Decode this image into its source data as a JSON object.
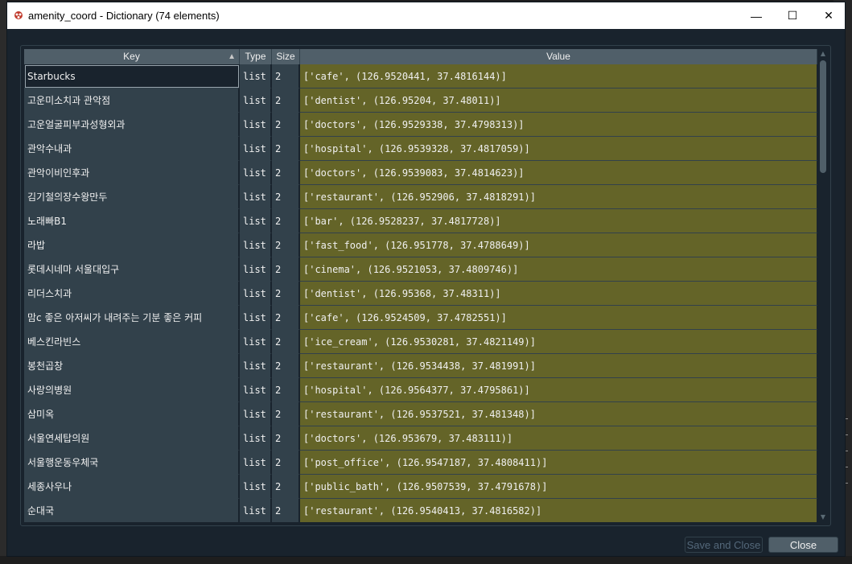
{
  "window": {
    "title": "amenity_coord - Dictionary (74 elements)",
    "controls": {
      "minimize": "—",
      "maximize": "☐",
      "close": "✕"
    }
  },
  "table": {
    "headers": {
      "key": "Key",
      "type": "Type",
      "size": "Size",
      "value": "Value"
    },
    "sort_indicator": "▲",
    "rows": [
      {
        "key": "Starbucks",
        "type": "list",
        "size": "2",
        "value": "['cafe', (126.9520441, 37.4816144)]"
      },
      {
        "key": "고운미소치과 관악점",
        "type": "list",
        "size": "2",
        "value": "['dentist', (126.95204, 37.48011)]"
      },
      {
        "key": "고운얼굴피부과성형외과",
        "type": "list",
        "size": "2",
        "value": "['doctors', (126.9529338, 37.4798313)]"
      },
      {
        "key": "관악수내과",
        "type": "list",
        "size": "2",
        "value": "['hospital', (126.9539328, 37.4817059)]"
      },
      {
        "key": "관악이비인후과",
        "type": "list",
        "size": "2",
        "value": "['doctors', (126.9539083, 37.4814623)]"
      },
      {
        "key": "김기철의장수왕만두",
        "type": "list",
        "size": "2",
        "value": "['restaurant', (126.952906, 37.4818291)]"
      },
      {
        "key": "노래빠B1",
        "type": "list",
        "size": "2",
        "value": "['bar', (126.9528237, 37.4817728)]"
      },
      {
        "key": "라밥",
        "type": "list",
        "size": "2",
        "value": "['fast_food', (126.951778, 37.4788649)]"
      },
      {
        "key": "롯데시네마 서울대입구",
        "type": "list",
        "size": "2",
        "value": "['cinema', (126.9521053, 37.4809746)]"
      },
      {
        "key": "리더스치과",
        "type": "list",
        "size": "2",
        "value": "['dentist', (126.95368, 37.48311)]"
      },
      {
        "key": "맘c 좋은 아저씨가 내려주는 기분 좋은 커피",
        "type": "list",
        "size": "2",
        "value": "['cafe', (126.9524509, 37.4782551)]"
      },
      {
        "key": "베스킨라빈스",
        "type": "list",
        "size": "2",
        "value": "['ice_cream', (126.9530281, 37.4821149)]"
      },
      {
        "key": "봉천곱창",
        "type": "list",
        "size": "2",
        "value": "['restaurant', (126.9534438, 37.481991)]"
      },
      {
        "key": "사랑의병원",
        "type": "list",
        "size": "2",
        "value": "['hospital', (126.9564377, 37.4795861)]"
      },
      {
        "key": "삼미옥",
        "type": "list",
        "size": "2",
        "value": "['restaurant', (126.9537521, 37.481348)]"
      },
      {
        "key": "서울연세탑의원",
        "type": "list",
        "size": "2",
        "value": "['doctors', (126.953679, 37.483111)]"
      },
      {
        "key": "서울행운동우체국",
        "type": "list",
        "size": "2",
        "value": "['post_office', (126.9547187, 37.4808411)]"
      },
      {
        "key": "세종사우나",
        "type": "list",
        "size": "2",
        "value": "['public_bath', (126.9507539, 37.4791678)]"
      },
      {
        "key": "순대국",
        "type": "list",
        "size": "2",
        "value": "['restaurant', (126.9540413, 37.4816582)]"
      }
    ]
  },
  "buttons": {
    "save_and_close": "Save and Close",
    "close": "Close"
  },
  "colors": {
    "background": "#19232d",
    "header": "#505f69",
    "key_cell": "#32414b",
    "value_cell": "#646428",
    "text": "#f0f0f0"
  }
}
